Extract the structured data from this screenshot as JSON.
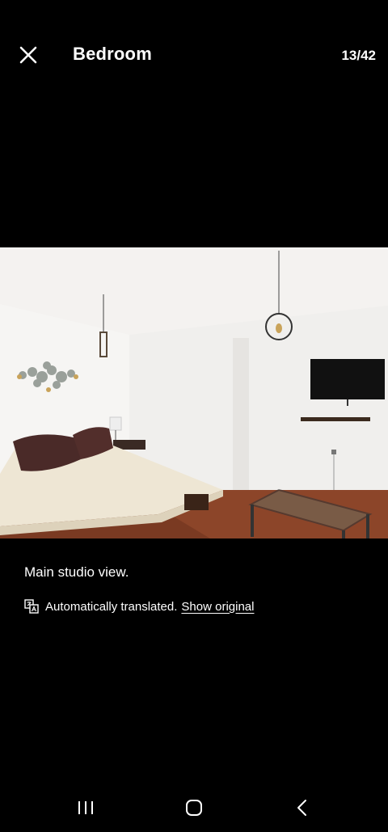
{
  "header": {
    "title": "Bedroom",
    "counter": "13/42",
    "close_icon": "close-icon"
  },
  "photo": {
    "description_icon": "room-photo"
  },
  "caption": {
    "text": "Main studio view.",
    "translated_label": "Automatically translated.",
    "show_original_label": "Show original",
    "translate_icon": "translate-icon"
  },
  "navbar": {
    "recent_icon": "recent-apps-icon",
    "home_icon": "home-icon",
    "back_icon": "back-icon"
  },
  "colors": {
    "background": "#000000",
    "text": "#ffffff"
  }
}
